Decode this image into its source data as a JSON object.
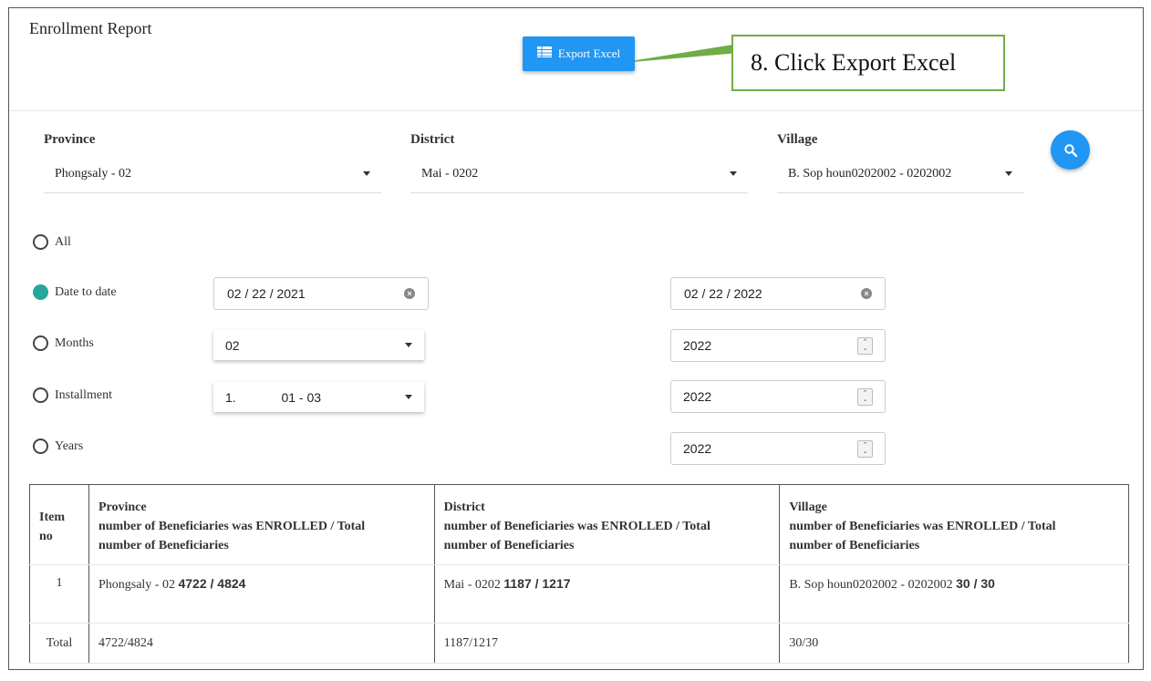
{
  "header": {
    "title": "Enrollment Report",
    "export_label": "Export Excel",
    "callout": "8. Click Export Excel"
  },
  "filters": {
    "province": {
      "label": "Province",
      "value": "Phongsaly - 02"
    },
    "district": {
      "label": "District",
      "value": "Mai - 0202"
    },
    "village": {
      "label": "Village",
      "value": "B. Sop houn0202002 - 0202002"
    }
  },
  "options": {
    "all": "All",
    "date_to_date": "Date to date",
    "months": "Months",
    "installment": "Installment",
    "years": "Years",
    "selected": "date_to_date"
  },
  "inputs": {
    "date_from": "02 / 22 / 2021",
    "date_to": "02 / 22 / 2022",
    "month": "02",
    "month_year": "2022",
    "installment_num": "1.",
    "installment_range": "01 - 03",
    "installment_year": "2022",
    "year": "2022"
  },
  "table": {
    "headers": {
      "item": [
        "Item",
        "no"
      ],
      "province": [
        "Province",
        "number of Beneficiaries was ENROLLED / Total",
        "number of Beneficiaries"
      ],
      "district": [
        "District",
        "number of Beneficiaries was ENROLLED / Total",
        "number of Beneficiaries"
      ],
      "village": [
        "Village",
        "number of Beneficiaries was ENROLLED / Total",
        "number of Beneficiaries"
      ]
    },
    "rows": [
      {
        "item": "1",
        "province_name": "Phongsaly - 02",
        "province_val": "4722 / 4824",
        "district_name": "Mai - 0202",
        "district_val": "1187 / 1217",
        "village_name": "B. Sop houn0202002 - 0202002",
        "village_val": "30 / 30"
      }
    ],
    "total": {
      "label": "Total",
      "province": "4722/4824",
      "district": "1187/1217",
      "village": "30/30"
    }
  },
  "colors": {
    "primary": "#2196f3",
    "radio_checked": "#26a69a",
    "callout_border": "#70ad47"
  }
}
